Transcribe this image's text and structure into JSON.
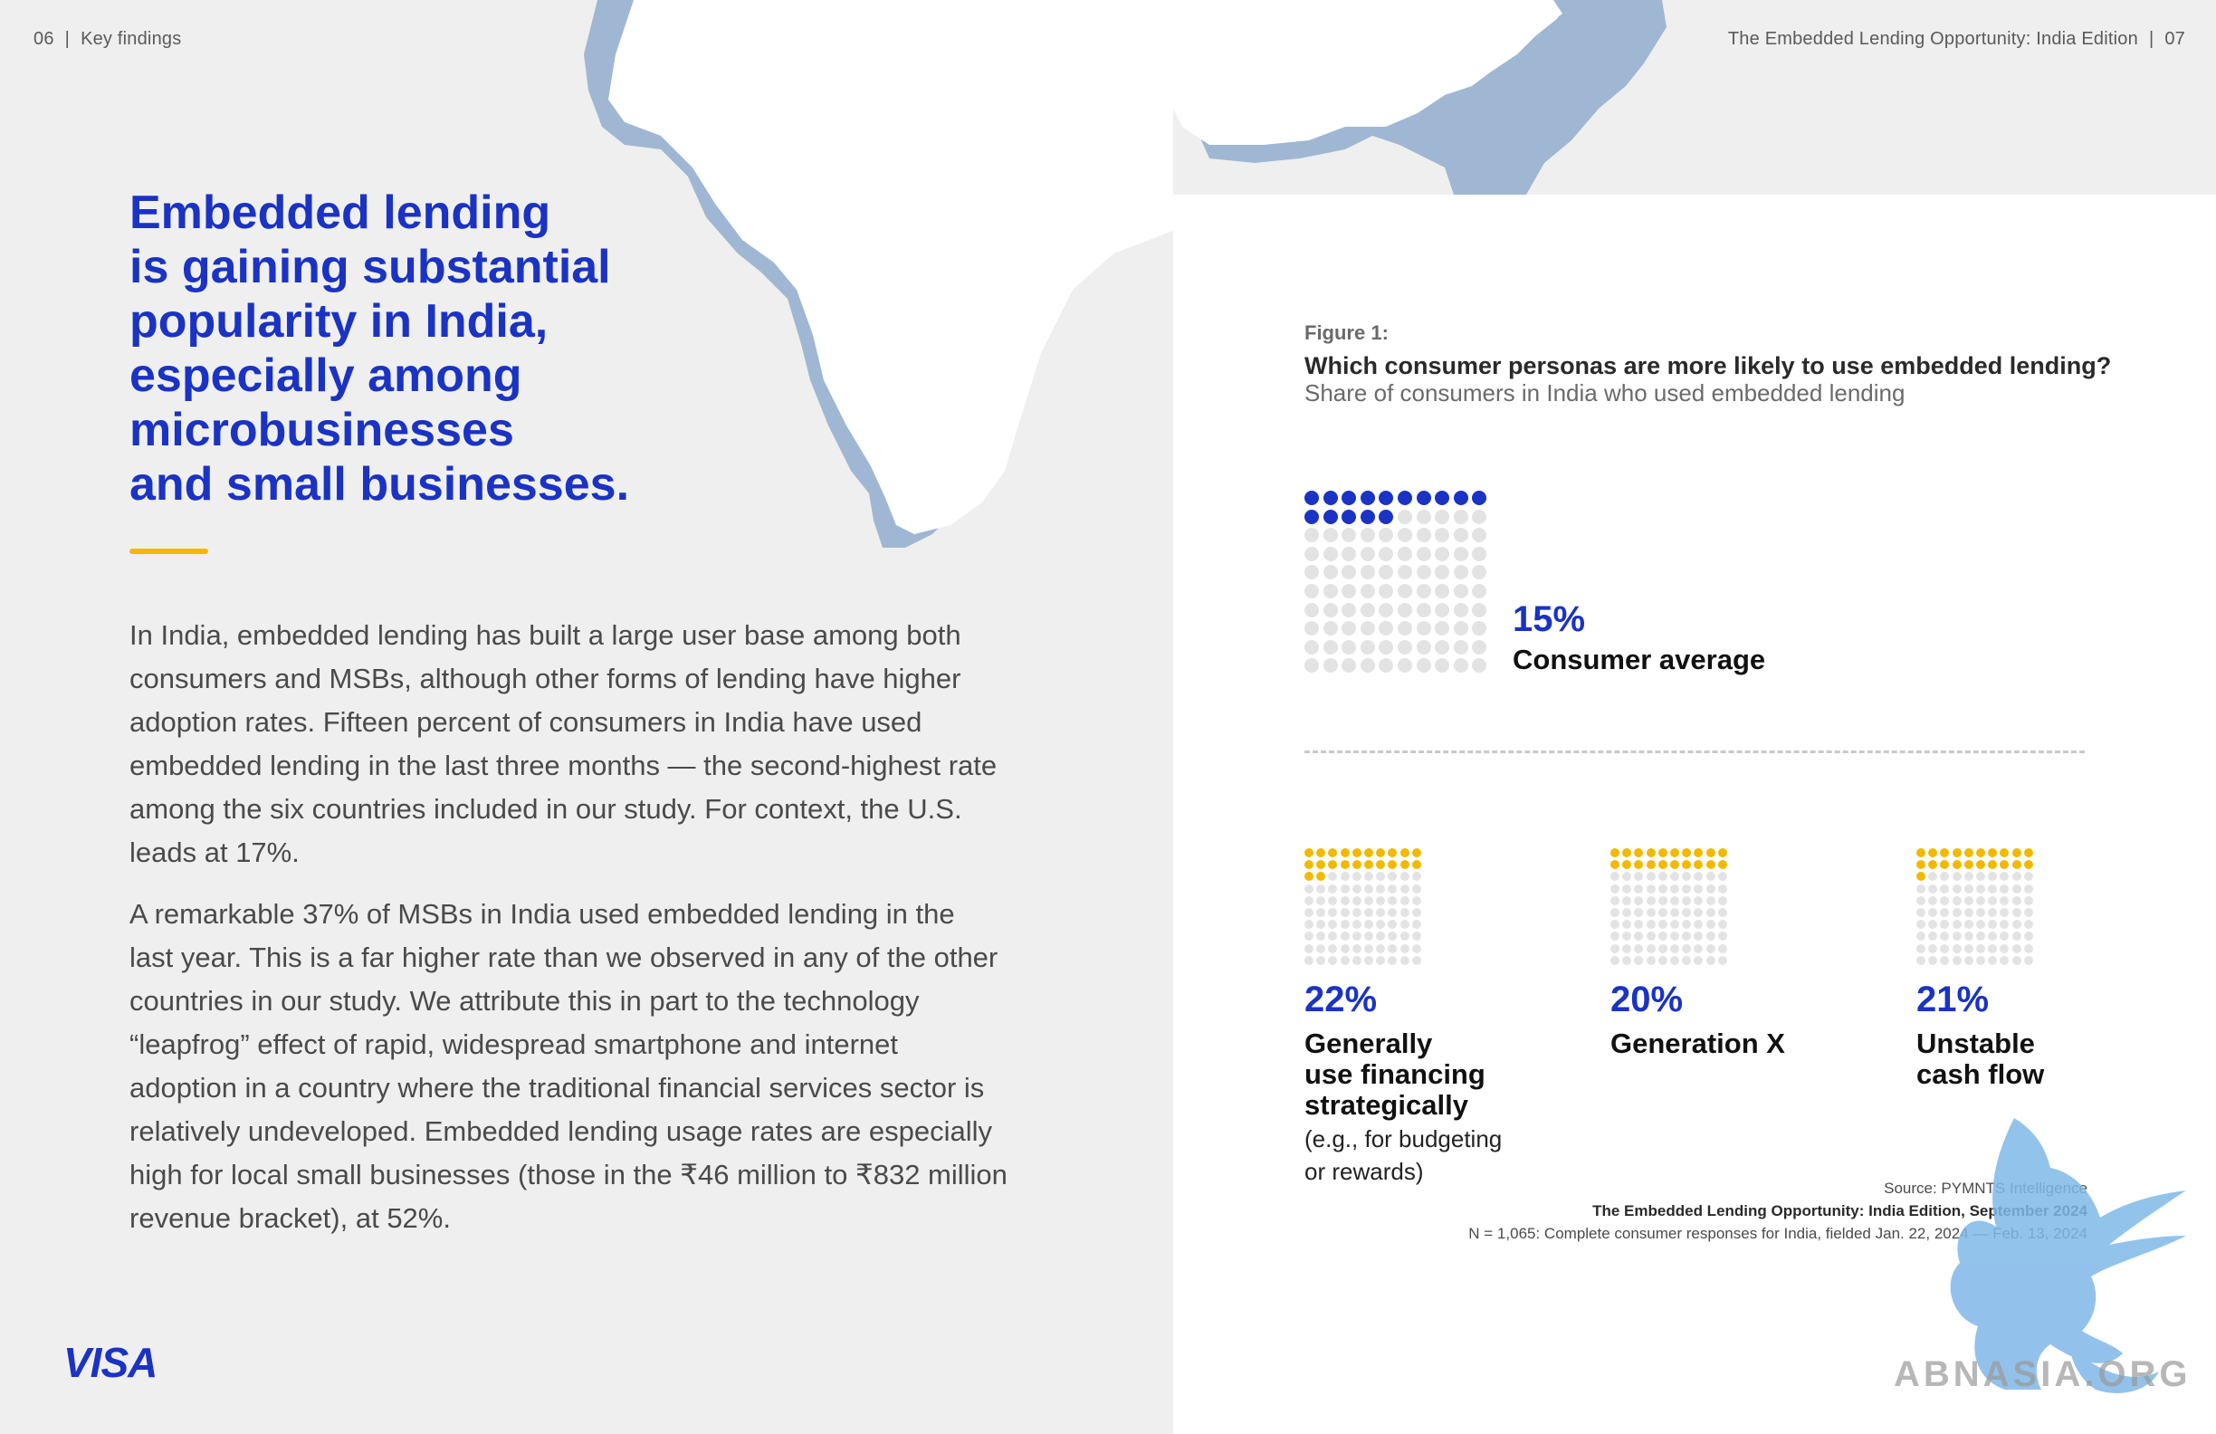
{
  "header": {
    "left_page_number": "06",
    "left_section": "Key findings",
    "right_title": "The Embedded Lending Opportunity: India Edition",
    "right_page_number": "07",
    "separator": "|"
  },
  "headline": {
    "lines": [
      "Embedded lending",
      "is gaining substantial",
      "popularity in India,",
      "especially among",
      "microbusinesses",
      "and small businesses."
    ]
  },
  "body": {
    "paragraph_1": [
      "In India, embedded lending has built a large user base among both",
      "consumers and MSBs, although other forms of lending have higher",
      "adoption rates. Fifteen percent of consumers in India have used",
      "embedded lending in the last three months — the second-highest rate",
      "among the six countries included in our study. For context, the U.S.",
      "leads at 17%."
    ],
    "paragraph_2": [
      "A remarkable 37% of MSBs in India used embedded lending in the",
      "last year. This is a far higher rate than we observed in any of the other",
      "countries in our study. We attribute this in part to the technology",
      "“leapfrog” effect of rapid, widespread smartphone and internet",
      "adoption in a country where the traditional financial services sector is",
      "relatively undeveloped. Embedded lending usage rates are especially",
      "high for local small businesses (those in the ₹46 million to ₹832 million",
      "revenue bracket), at 52%."
    ]
  },
  "brand": {
    "logo_text": "VISA",
    "logo_color": "#1a33c4"
  },
  "figure": {
    "label": "Figure 1:",
    "question": "Which consumer personas are more likely to use embedded lending?",
    "subtitle": "Share of consumers in India who used embedded lending",
    "source": "Source: PYMNTS Intelligence",
    "report": "The Embedded Lending Opportunity: India Edition, September 2024",
    "note": "N = 1,065: Complete consumer responses for India, fielded Jan. 22, 2024 — Feb. 13, 2024"
  },
  "chart_data": {
    "type": "waffle",
    "grid": "10x10",
    "unit_percent": 1,
    "colors": {
      "average": "#1a33c4",
      "personas": "#f2b900",
      "empty": "#e3e3e3"
    },
    "average": {
      "value": 15,
      "value_label": "15%",
      "label": "Consumer average"
    },
    "personas": [
      {
        "value": 22,
        "value_label": "22%",
        "label_lines": [
          "Generally",
          "use financing",
          "strategically"
        ],
        "note_lines": [
          "(e.g., for budgeting",
          "or rewards)"
        ]
      },
      {
        "value": 20,
        "value_label": "20%",
        "label_lines": [
          "Generation X"
        ],
        "note_lines": []
      },
      {
        "value": 21,
        "value_label": "21%",
        "label_lines": [
          "Unstable",
          "cash flow"
        ],
        "note_lines": []
      }
    ]
  },
  "watermark": {
    "text": "ABNASIA.ORG"
  }
}
